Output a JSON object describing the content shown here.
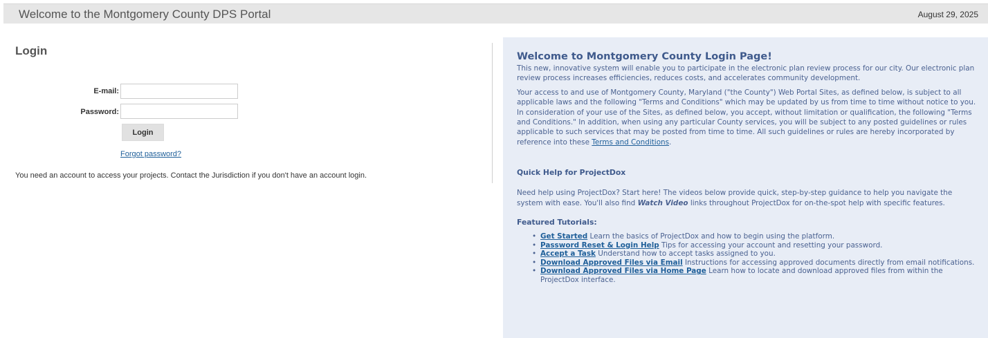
{
  "header": {
    "title": "Welcome to the Montgomery County DPS Portal",
    "date": "August 29, 2025"
  },
  "login": {
    "title": "Login",
    "email_label": "E-mail:",
    "email_value": "",
    "password_label": "Password:",
    "password_value": "",
    "button_label": "Login",
    "forgot_label": "Forgot password?",
    "account_note": "You need an account to access your projects. Contact the Jurisdiction if you don't have an account login."
  },
  "welcome": {
    "title": "Welcome to Montgomery County Login Page!",
    "intro": "This new, innovative system will enable you to participate in the electronic plan review process for our city. Our electronic plan review process increases efficiencies, reduces costs, and accelerates community development.",
    "terms_text": "Your access to and use of Montgomery County, Maryland (\"the County\") Web Portal Sites, as defined below, is subject to all applicable laws and the following \"Terms and Conditions\" which may be updated by us from time to time without notice to you. In consideration of your use of the Sites, as defined below, you accept, without limitation or qualification, the following \"Terms and Conditions.\" In addition, when using any particular County services, you will be subject to any posted guidelines or rules applicable to such services that may be posted from time to time. All such guidelines or rules are hereby incorporated by reference into these ",
    "terms_link": "Terms and Conditions",
    "terms_end": ".",
    "quick_help_heading": "Quick Help for ProjectDox",
    "quick_help_pre": "Need help using ProjectDox? Start here! The videos below provide quick, step-by-step guidance to help you navigate the system with ease. You'll also find ",
    "quick_help_em": "Watch Video",
    "quick_help_post": " links throughout ProjectDox for on-the-spot help with specific features.",
    "featured_heading": "Featured Tutorials:",
    "bullet": "•",
    "tutorials": [
      {
        "link": "Get Started",
        "desc": " Learn the basics of ProjectDox and how to begin using the platform."
      },
      {
        "link": "Password Reset & Login Help",
        "desc": " Tips for accessing your account and resetting your password."
      },
      {
        "link": "Accept a Task",
        "desc": " Understand how to accept tasks assigned to you."
      },
      {
        "link": "Download Approved Files via Email",
        "desc": " Instructions for accessing approved documents directly from email notifications."
      },
      {
        "link": "Download Approved Files via Home Page",
        "desc": " Learn how to locate and download approved files from within the ProjectDox interface."
      }
    ]
  }
}
